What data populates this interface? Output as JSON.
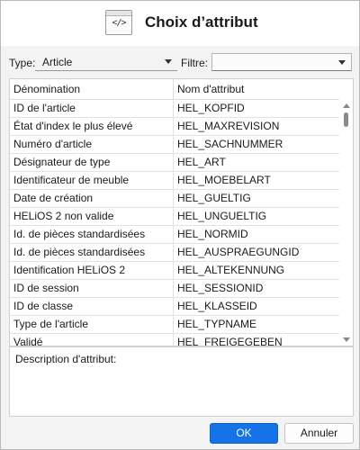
{
  "dialog": {
    "title": "Choix d’attribut",
    "icon": "code-window-icon",
    "icon_glyph": "</>"
  },
  "type_field": {
    "label": "Type:",
    "value": "Article"
  },
  "filter_field": {
    "label": "Filtre:",
    "value": ""
  },
  "table": {
    "columns": [
      "Dénomination",
      "Nom d'attribut"
    ],
    "rows": [
      [
        "ID de l'article",
        "HEL_KOPFID"
      ],
      [
        "État d'index le plus élevé",
        "HEL_MAXREVISION"
      ],
      [
        "Numéro d'article",
        "HEL_SACHNUMMER"
      ],
      [
        "Désignateur de type",
        "HEL_ART"
      ],
      [
        "Identificateur de meuble",
        "HEL_MOEBELART"
      ],
      [
        "Date de création",
        "HEL_GUELTIG"
      ],
      [
        "HELiOS 2 non valide",
        "HEL_UNGUELTIG"
      ],
      [
        "Id. de pièces standardisées",
        "HEL_NORMID"
      ],
      [
        "Id. de pièces standardisées",
        "HEL_AUSPRAEGUNGID"
      ],
      [
        "Identification HELiOS 2",
        "HEL_ALTEKENNUNG"
      ],
      [
        "ID de session",
        "HEL_SESSIONID"
      ],
      [
        "ID de classe",
        "HEL_KLASSEID"
      ],
      [
        "Type de l'article",
        "HEL_TYPNAME"
      ],
      [
        "Validé",
        "HEL_FREIGEGEBEN"
      ]
    ]
  },
  "description": {
    "label": "Description d'attribut:"
  },
  "buttons": {
    "ok": "OK",
    "cancel": "Annuler"
  },
  "colors": {
    "accent": "#1473e6",
    "window_bg": "#f3f3f3"
  }
}
